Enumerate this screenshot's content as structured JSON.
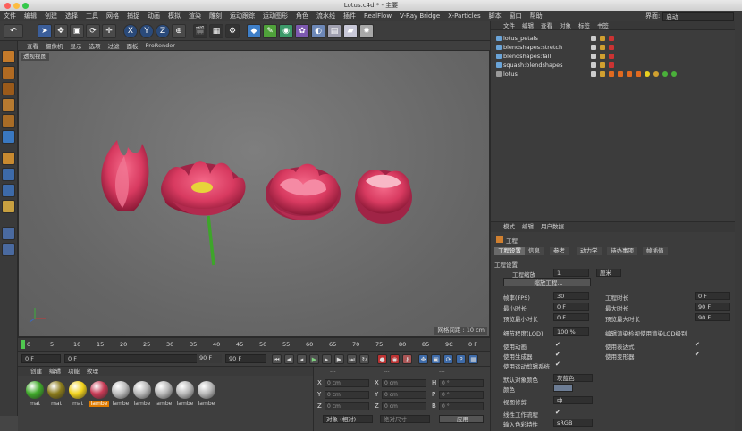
{
  "window": {
    "title": "Lotus.c4d * - 主要"
  },
  "menubar": {
    "items": [
      "文件",
      "编辑",
      "创建",
      "选择",
      "工具",
      "网格",
      "捕捉",
      "动画",
      "模拟",
      "渲染",
      "雕刻",
      "运动跟踪",
      "运动图形",
      "角色",
      "流水线",
      "插件",
      "RealFlow",
      "V-Ray Bridge",
      "X-Particles",
      "脚本",
      "窗口",
      "帮助"
    ],
    "layout_label": "界面:",
    "layout_value": "启动"
  },
  "toolbar": {
    "axis_x": "X",
    "axis_y": "Y",
    "axis_z": "Z"
  },
  "viewport": {
    "menu": [
      "查看",
      "摄像机",
      "显示",
      "选项",
      "过滤",
      "面板",
      "ProRender"
    ],
    "label": "透视视图",
    "grid_info": "网格间距 : 10 cm"
  },
  "timeline": {
    "ticks": [
      "0",
      "5",
      "10",
      "15",
      "20",
      "25",
      "30",
      "35",
      "40",
      "45",
      "50",
      "55",
      "60",
      "65",
      "70",
      "75",
      "80",
      "85",
      "9C"
    ],
    "end_label": "0 F"
  },
  "transport": {
    "current": "0 F",
    "start": "0 F",
    "end_a": "90 F",
    "end_b": "90 F"
  },
  "materials": {
    "menu": [
      "创建",
      "编辑",
      "功能",
      "纹理"
    ],
    "items": [
      {
        "name": "mat",
        "color": "#3faa2a"
      },
      {
        "name": "mat",
        "color": "#8a7a1a"
      },
      {
        "name": "mat",
        "color": "#f2d21b"
      },
      {
        "name": "lambe",
        "color": "#c83a55"
      },
      {
        "name": "lambe",
        "color": "#bdbdbd"
      },
      {
        "name": "lambe",
        "color": "#b8b8b8"
      },
      {
        "name": "lambe",
        "color": "#b8b8b8"
      },
      {
        "name": "lambe",
        "color": "#b8b8b8"
      },
      {
        "name": "lambe",
        "color": "#b8b8b8"
      }
    ],
    "selected_index": 3
  },
  "coordinates": {
    "header_a": "---",
    "header_b": "---",
    "header_c": "---",
    "rows": [
      {
        "a": "X",
        "av": "0 cm",
        "b": "X",
        "bv": "0 cm",
        "c": "H",
        "cv": "0 °"
      },
      {
        "a": "Y",
        "av": "0 cm",
        "b": "Y",
        "bv": "0 cm",
        "c": "P",
        "cv": "0 °"
      },
      {
        "a": "Z",
        "av": "0 cm",
        "b": "Z",
        "bv": "0 cm",
        "c": "B",
        "cv": "0 °"
      }
    ],
    "mode": "对象 (相对)",
    "size_mode": "绝对尺寸",
    "apply": "应用"
  },
  "objects": {
    "menu": [
      "文件",
      "编辑",
      "查看",
      "对象",
      "标签",
      "书签"
    ],
    "items": [
      "lotus_petals",
      "blendshapes:stretch",
      "blendshapes:fall",
      "squash:blendshapes",
      "lotus"
    ]
  },
  "attributes": {
    "menu": [
      "模式",
      "编辑",
      "用户数据"
    ],
    "header": "工程",
    "tabs": [
      "工程设置",
      "信息",
      "参考",
      "动力学",
      "待办事项",
      "帧插值"
    ],
    "section": "工程设置",
    "scale_label": "工程缩放",
    "scale_value": "1",
    "scale_unit": "厘米",
    "scale_button": "缩放工程...",
    "fps_label": "帧率(FPS)",
    "fps_value": "30",
    "project_time_label": "工程时长",
    "project_time_value": "0 F",
    "min_time_label": "最小时长",
    "min_time_value": "0 F",
    "max_time_label": "最大时长",
    "max_time_value": "90 F",
    "preview_min_label": "预览最小时长",
    "preview_min_value": "0 F",
    "preview_max_label": "预览最大时长",
    "preview_max_value": "90 F",
    "lod_label": "细节程度(LOD)",
    "lod_value": "100 %",
    "lod_render_label": "编辑渲染检视使用渲染LOD级别",
    "use_anim_label": "使用动画",
    "use_expr_label": "使用表达式",
    "use_gen_label": "使用生成器",
    "use_deform_label": "使用变形器",
    "use_motion_label": "使用运动剪辑系统",
    "default_color_label": "默认对象颜色",
    "default_color_value": "灰蓝色",
    "color_label": "颜色",
    "clipping_label": "视图修剪",
    "clipping_value": "中",
    "linear_label": "线性工作流程",
    "input_color_label": "输入色彩特性",
    "input_color_value": "sRGB",
    "check": "✔"
  }
}
